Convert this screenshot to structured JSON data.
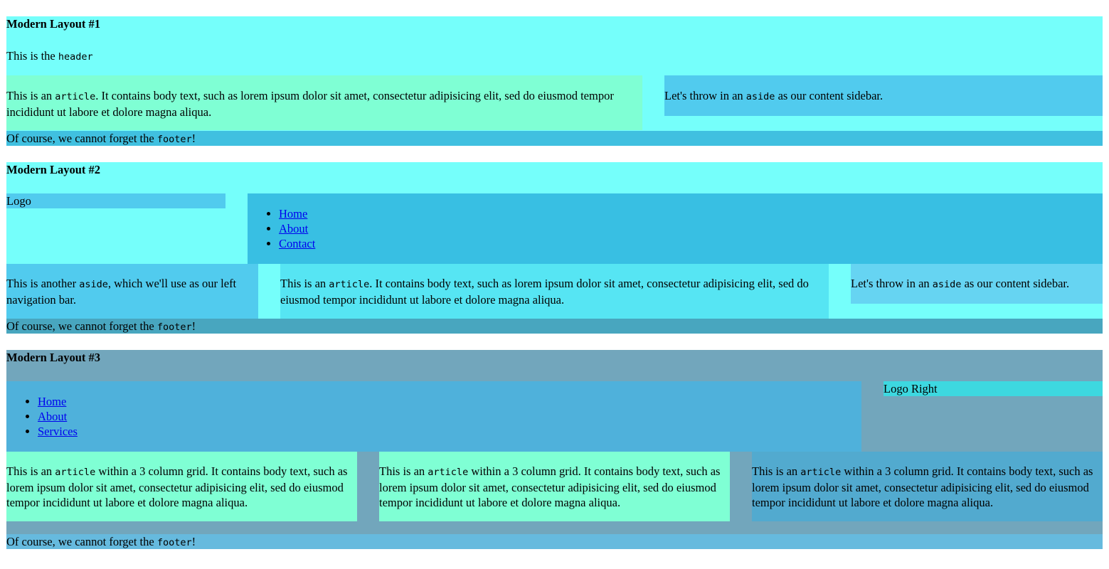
{
  "layout1": {
    "title": "Modern Layout #1",
    "header_text": "This is the ",
    "header_code": "header",
    "article_pre": "This is an ",
    "article_code": "article",
    "article_post": ". It contains body text, such as lorem ipsum dolor sit amet, consectetur adipisicing elit, sed do eiusmod tempor incididunt ut labore et dolore magna aliqua.",
    "aside_pre": "Let's throw in an ",
    "aside_code": "aside",
    "aside_post": " as our content sidebar.",
    "footer_pre": "Of course, we cannot forget the ",
    "footer_code": "footer",
    "footer_post": "!"
  },
  "layout2": {
    "title": "Modern Layout #2",
    "logo": "Logo",
    "nav": [
      "Home",
      "About",
      "Contact"
    ],
    "left_aside_pre": "This is another ",
    "left_aside_code": "aside",
    "left_aside_post": ", which we'll use as our left navigation bar.",
    "article_pre": "This is an ",
    "article_code": "article",
    "article_post": ". It contains body text, such as lorem ipsum dolor sit amet, consectetur adipisicing elit, sed do eiusmod tempor incididunt ut labore et dolore magna aliqua.",
    "aside_pre": "Let's throw in an ",
    "aside_code": "aside",
    "aside_post": " as our content sidebar.",
    "footer_pre": "Of course, we cannot forget the ",
    "footer_code": "footer",
    "footer_post": "!"
  },
  "layout3": {
    "title": "Modern Layout #3",
    "nav": [
      "Home",
      "About",
      "Services"
    ],
    "logo": "Logo Right",
    "articles": [
      {
        "pre": "This is an ",
        "code": "article",
        "post": " within a 3 column grid. It contains body text, such as lorem ipsum dolor sit amet, consectetur adipisicing elit, sed do eiusmod tempor incididunt ut labore et dolore magna aliqua."
      },
      {
        "pre": "This is an ",
        "code": "article",
        "post": " within a 3 column grid. It contains body text, such as lorem ipsum dolor sit amet, consectetur adipisicing elit, sed do eiusmod tempor incididunt ut labore et dolore magna aliqua."
      },
      {
        "pre": "This is an ",
        "code": "article",
        "post": " within a 3 column grid. It contains body text, such as lorem ipsum dolor sit amet, consectetur adipisicing elit, sed do eiusmod tempor incididunt ut labore et dolore magna aliqua."
      }
    ],
    "footer_pre": "Of course, we cannot forget the ",
    "footer_code": "footer",
    "footer_post": "!"
  },
  "colors": {
    "layout1_bg": "#75fffb",
    "layout1_article": "#7fffd4",
    "layout1_aside": "#51cbee",
    "layout1_footer": "#40c0e0",
    "layout2_bg": "#75fffb",
    "layout2_logo": "#51cbee",
    "layout2_nav": "#38bfe3",
    "layout2_left_aside": "#51cbee",
    "layout2_article": "#56e5f3",
    "layout2_aside": "#66d4f2",
    "layout2_footer": "#48a6bf",
    "layout3_bg": "#72a6bc",
    "layout3_nav": "#4fb1db",
    "layout3_logo": "#3dd8e0",
    "layout3_article": "#7fffd4",
    "layout3_article_alt": "#52aacf",
    "layout3_footer": "#66bade"
  }
}
